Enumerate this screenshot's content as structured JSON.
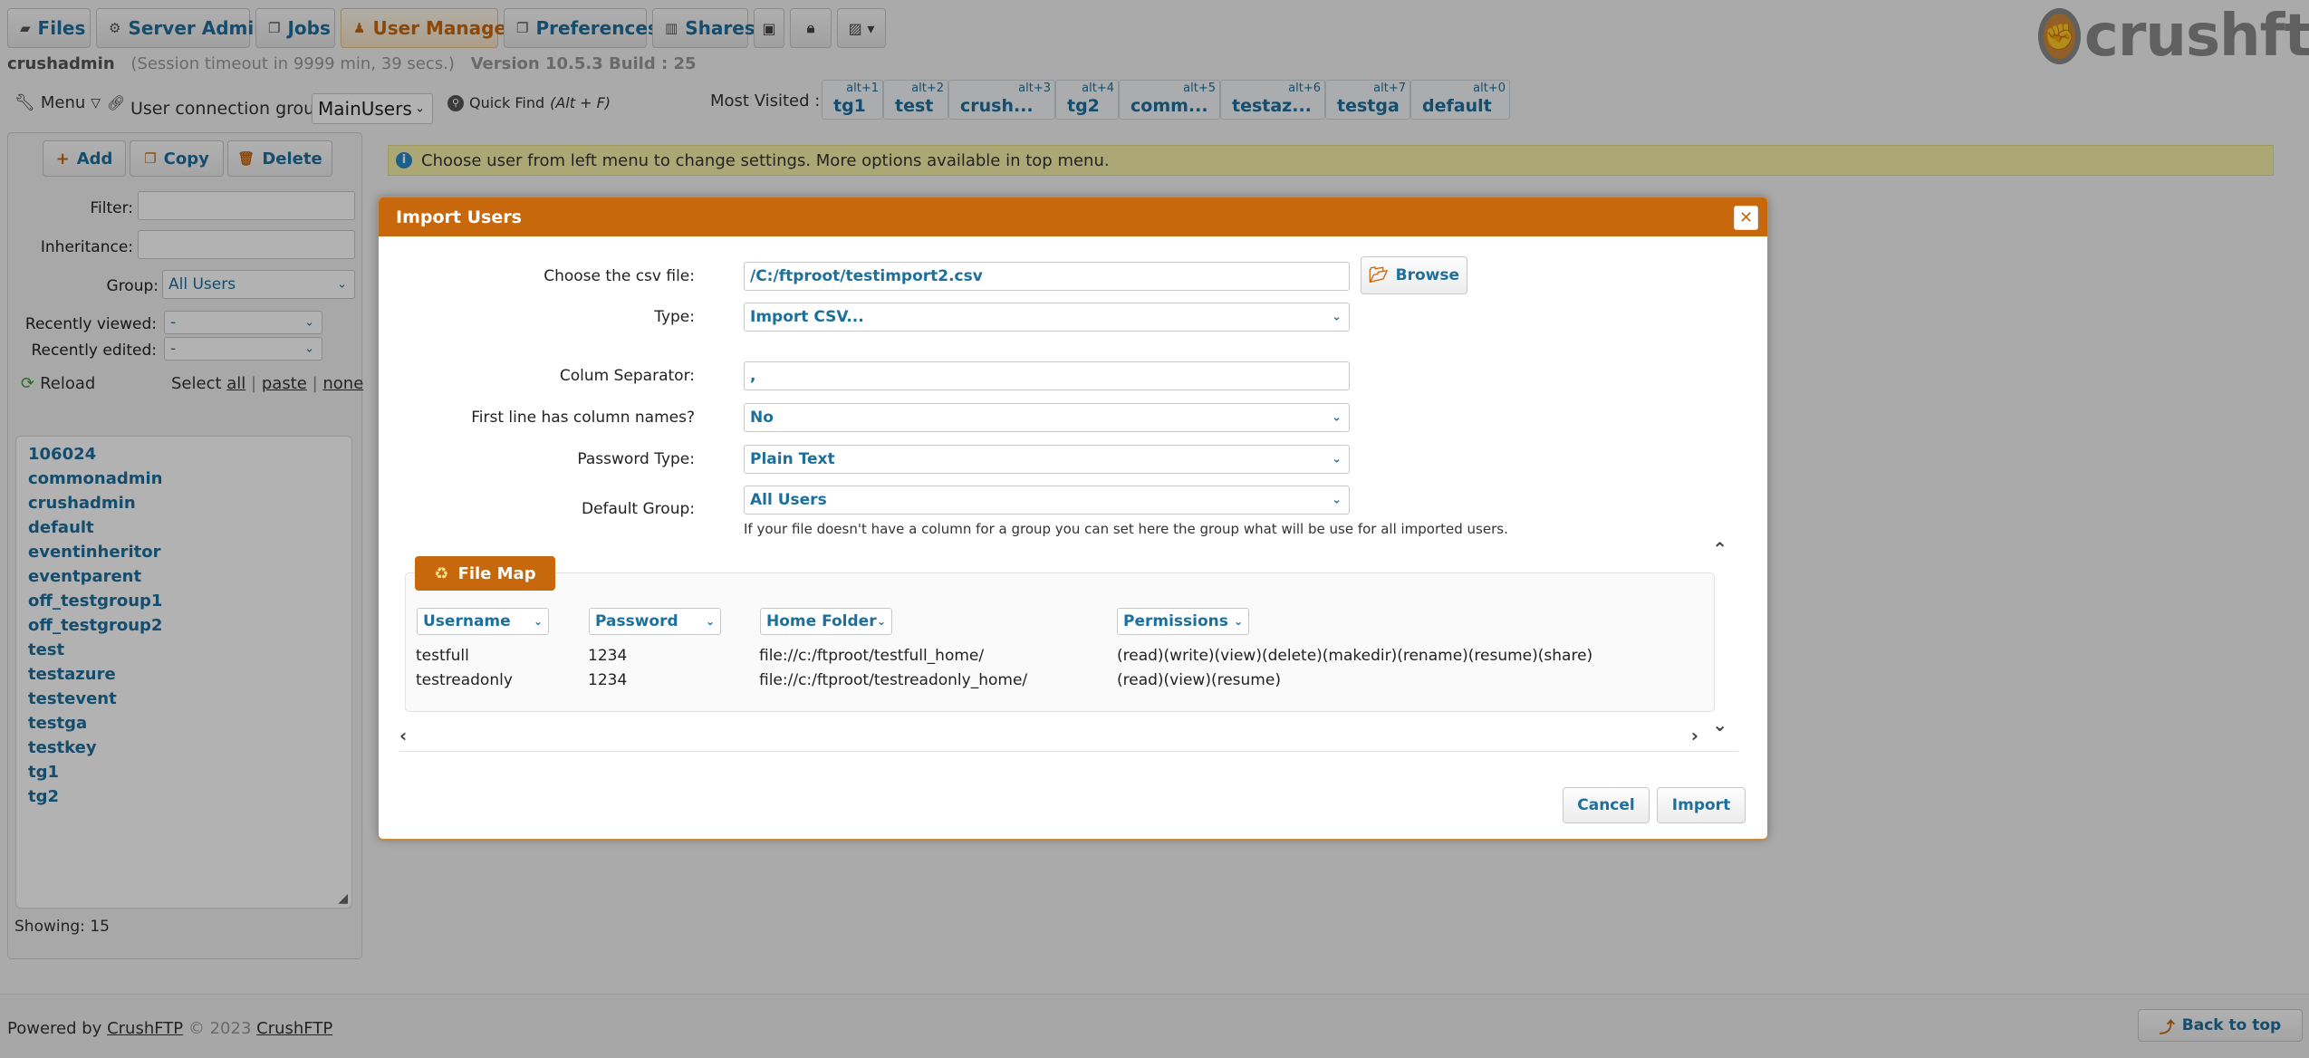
{
  "top_tabs": [
    {
      "label": "Files",
      "icon": "folder-icon"
    },
    {
      "label": "Server Admin",
      "icon": "gear-icon"
    },
    {
      "label": "Jobs",
      "icon": "copy-icon"
    },
    {
      "label": "User Manager",
      "icon": "user-icon"
    },
    {
      "label": "Preferences",
      "icon": "copy-icon"
    },
    {
      "label": "Shares",
      "icon": "share-icon"
    }
  ],
  "session": {
    "user": "crushadmin",
    "timeout": "(Session timeout in 9999 min, 39 secs.)",
    "version": "Version 10.5.3 Build : 25"
  },
  "logo": {
    "text": "crushftp"
  },
  "toolbar": {
    "menu_label": "Menu",
    "group_label": "User connection group:",
    "group_value": "MainUsers",
    "quick_find": "Quick Find",
    "quick_find_hint": "(Alt + F)",
    "most_visited_label": "Most Visited :"
  },
  "most_visited": [
    {
      "alt": "alt+1",
      "name": "tg1"
    },
    {
      "alt": "alt+2",
      "name": "test"
    },
    {
      "alt": "alt+3",
      "name": "crush..."
    },
    {
      "alt": "alt+4",
      "name": "tg2"
    },
    {
      "alt": "alt+5",
      "name": "comm..."
    },
    {
      "alt": "alt+6",
      "name": "testaz..."
    },
    {
      "alt": "alt+7",
      "name": "testga"
    },
    {
      "alt": "alt+0",
      "name": "default"
    }
  ],
  "sidebar": {
    "add": "Add",
    "copy": "Copy",
    "delete": "Delete",
    "filter_label": "Filter:",
    "inheritance_label": "Inheritance:",
    "group_label": "Group:",
    "group_value": "All Users",
    "recent_viewed_label": "Recently viewed:",
    "recent_viewed_value": "-",
    "recent_edited_label": "Recently edited:",
    "recent_edited_value": "-",
    "reload": "Reload",
    "select": "Select",
    "all": "all",
    "paste": "paste",
    "none": "none",
    "users": [
      "106024",
      "commonadmin",
      "crushadmin",
      "default",
      "eventinheritor",
      "eventparent",
      "off_testgroup1",
      "off_testgroup2",
      "test",
      "testazure",
      "testevent",
      "testga",
      "testkey",
      "tg1",
      "tg2"
    ],
    "showing": "Showing: 15"
  },
  "info_banner": "Choose user from left menu to change settings. More options available in top menu.",
  "dialog": {
    "title": "Import Users",
    "csv_label": "Choose the csv file:",
    "csv_value": "/C:/ftproot/testimport2.csv",
    "browse": "Browse",
    "type_label": "Type:",
    "type_value": "Import CSV...",
    "sep_label": "Colum Separator:",
    "sep_value": ",",
    "firstline_label": "First line has column names?",
    "firstline_value": "No",
    "pwtype_label": "Password Type:",
    "pwtype_value": "Plain Text",
    "defgroup_label": "Default Group:",
    "defgroup_value": "All Users",
    "defgroup_hint": "If your file doesn't have a column for a group you can set here the group what will be use for all imported users.",
    "filemap_title": "File Map",
    "columns": [
      "Username",
      "Password",
      "Home Folder",
      "Permissions"
    ],
    "rows": [
      [
        "testfull",
        "1234",
        "file://c:/ftproot/testfull_home/",
        "(read)(write)(view)(delete)(makedir)(rename)(resume)(share)"
      ],
      [
        "testreadonly",
        "1234",
        "file://c:/ftproot/testreadonly_home/",
        "(read)(view)(resume)"
      ]
    ],
    "cancel": "Cancel",
    "import": "Import"
  },
  "footer": {
    "powered": "Powered by",
    "brand": "CrushFTP",
    "copyright": "© 2023",
    "brand2": "CrushFTP",
    "back_to_top": "Back to top"
  }
}
